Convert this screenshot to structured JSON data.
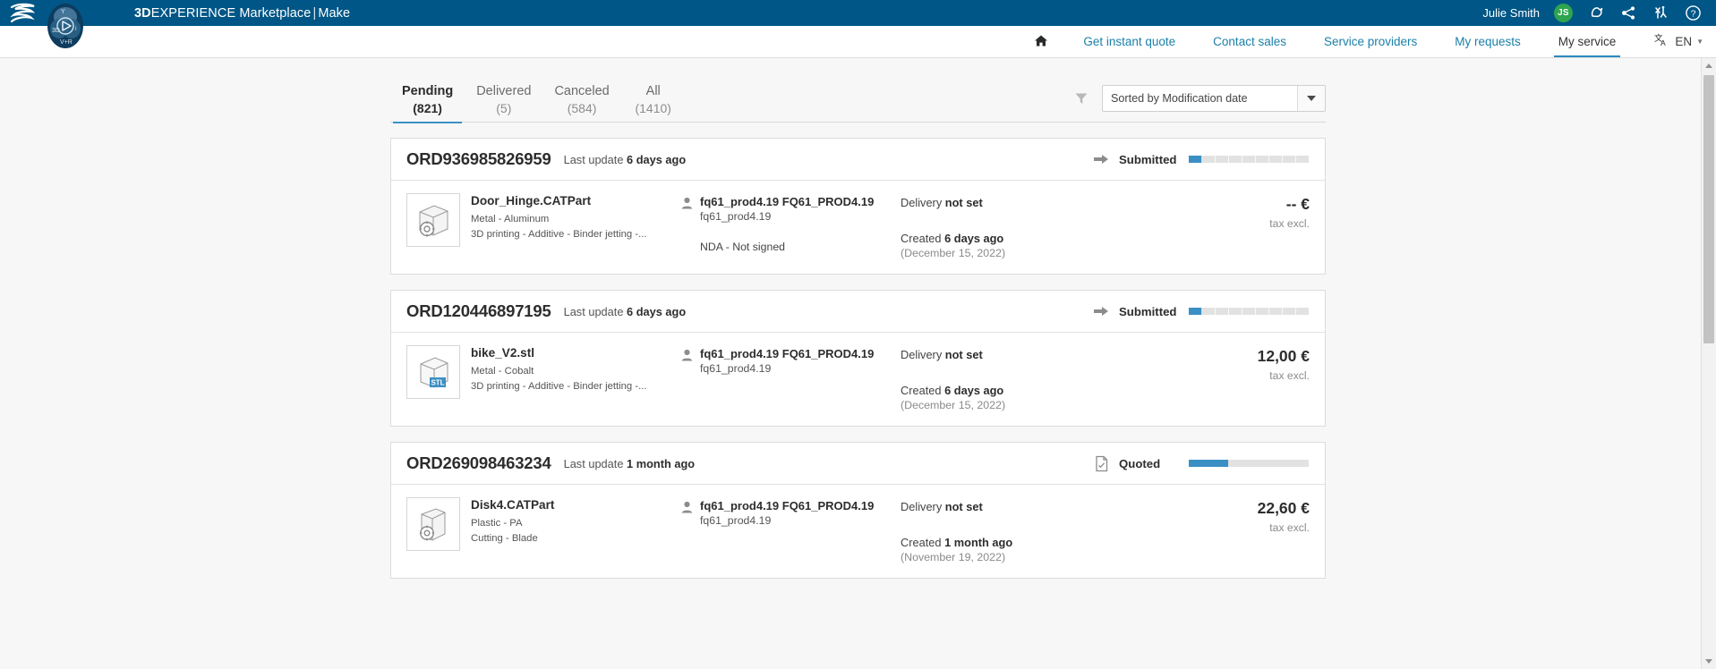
{
  "header": {
    "brand_bold": "3D",
    "brand_rest": "EXPERIENCE Marketplace",
    "brand_sep": "|",
    "brand_app": "Make",
    "user_name": "Julie Smith",
    "user_initials": "JS",
    "icons": [
      "notification-bell-icon",
      "share-network-icon",
      "collaboration-icon",
      "help-icon"
    ]
  },
  "nav": {
    "home_label": "",
    "items": [
      {
        "label": "Get instant quote",
        "active": false
      },
      {
        "label": "Contact sales",
        "active": false
      },
      {
        "label": "Service providers",
        "active": false
      },
      {
        "label": "My requests",
        "active": false
      },
      {
        "label": "My service",
        "active": true
      }
    ],
    "language": "EN"
  },
  "toolbar": {
    "tabs": [
      {
        "label": "Pending",
        "count": "(821)",
        "active": true
      },
      {
        "label": "Delivered",
        "count": "(5)",
        "active": false
      },
      {
        "label": "Canceled",
        "count": "(584)",
        "active": false
      },
      {
        "label": "All",
        "count": "(1410)",
        "active": false
      }
    ],
    "filter_icon": "filter-funnel-icon",
    "sort_value": "Sorted by Modification date"
  },
  "colors": {
    "brand_blue": "#005686",
    "link_blue": "#1b7fa8",
    "accent_blue": "#3a8fc4",
    "avatar_green": "#2ea44f"
  },
  "orders": [
    {
      "id": "ORD936985826959",
      "last_update_prefix": "Last update",
      "last_update_value": "6 days ago",
      "status_icon": "arrow-right-icon",
      "status": "Submitted",
      "progress_percent": 11,
      "file_name": "Door_Hinge.CATPart",
      "file_material": "Metal - Aluminum",
      "file_process": "3D printing - Additive - Binder jetting -...",
      "thumb_badge": "",
      "customer_name": "fq61_prod4.19 FQ61_PROD4.19",
      "customer_sub": "fq61_prod4.19",
      "nda": "NDA - Not signed",
      "delivery_label": "Delivery",
      "delivery_value": "not set",
      "created_label": "Created",
      "created_value": "6 days ago",
      "created_date": "(December 15, 2022)",
      "price": "-- €",
      "price_note": "tax excl."
    },
    {
      "id": "ORD120446897195",
      "last_update_prefix": "Last update",
      "last_update_value": "6 days ago",
      "status_icon": "arrow-right-icon",
      "status": "Submitted",
      "progress_percent": 11,
      "file_name": "bike_V2.stl",
      "file_material": "Metal - Cobalt",
      "file_process": "3D printing - Additive - Binder jetting -...",
      "thumb_badge": "STL",
      "customer_name": "fq61_prod4.19 FQ61_PROD4.19",
      "customer_sub": "fq61_prod4.19",
      "nda": "",
      "delivery_label": "Delivery",
      "delivery_value": "not set",
      "created_label": "Created",
      "created_value": "6 days ago",
      "created_date": "(December 15, 2022)",
      "price": "12,00 €",
      "price_note": "tax excl."
    },
    {
      "id": "ORD269098463234",
      "last_update_prefix": "Last update",
      "last_update_value": "1 month ago",
      "status_icon": "document-quote-icon",
      "status": "Quoted",
      "progress_percent": 33,
      "file_name": "Disk4.CATPart",
      "file_material": "Plastic - PA",
      "file_process": "Cutting - Blade",
      "thumb_badge": "",
      "customer_name": "fq61_prod4.19 FQ61_PROD4.19",
      "customer_sub": "fq61_prod4.19",
      "nda": "",
      "delivery_label": "Delivery",
      "delivery_value": "not set",
      "created_label": "Created",
      "created_value": "1 month ago",
      "created_date": "(November 19, 2022)",
      "price": "22,60 €",
      "price_note": "tax excl."
    }
  ]
}
